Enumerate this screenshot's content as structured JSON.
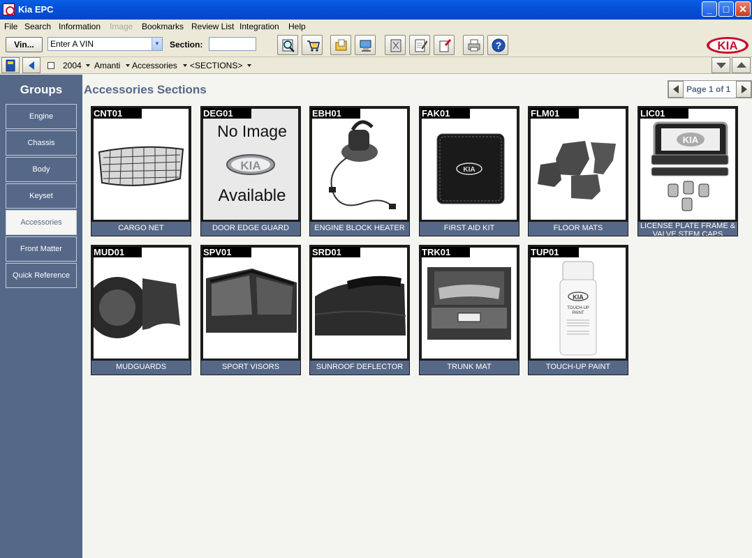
{
  "window": {
    "title": "Kia EPC",
    "minimize": "_",
    "maximize": "□",
    "close": "✕"
  },
  "menu": [
    {
      "label": "File",
      "disabled": false
    },
    {
      "label": "Search",
      "disabled": false
    },
    {
      "label": "Information",
      "disabled": false
    },
    {
      "label": "Image",
      "disabled": true
    },
    {
      "label": "Bookmarks",
      "disabled": false
    },
    {
      "label": "Review List",
      "disabled": false
    },
    {
      "label": "Integration",
      "disabled": false
    },
    {
      "label": "Help",
      "disabled": false
    }
  ],
  "toolbar": {
    "vin_button": "Vin...",
    "vin_select_value": "Enter A VIN",
    "section_label": "Section:",
    "section_value": "",
    "brand": "KIA"
  },
  "breadcrumb": {
    "year": "2004",
    "model": "Amanti",
    "group": "Accessories",
    "section": "<SECTIONS>"
  },
  "sidebar": {
    "heading": "Groups",
    "items": [
      {
        "label": "Engine",
        "active": false
      },
      {
        "label": "Chassis",
        "active": false
      },
      {
        "label": "Body",
        "active": false
      },
      {
        "label": "Keyset",
        "active": false
      },
      {
        "label": "Accessories",
        "active": true
      },
      {
        "label": "Front Matter",
        "active": false
      },
      {
        "label": "Quick Reference",
        "active": false
      }
    ]
  },
  "main": {
    "title": "Accessories Sections",
    "pager": "Page 1 of 1",
    "cards": [
      {
        "code": "CNT01",
        "label": "CARGO NET",
        "image": "cargo-net"
      },
      {
        "code": "DEG01",
        "label": "DOOR EDGE GUARD",
        "image": "no-image",
        "placeholder_top": "No Image",
        "placeholder_logo": "KIA",
        "placeholder_bottom": "Available"
      },
      {
        "code": "EBH01",
        "label": "ENGINE BLOCK HEATER",
        "image": "engine-block-heater"
      },
      {
        "code": "FAK01",
        "label": "FIRST AID KIT",
        "image": "first-aid-kit"
      },
      {
        "code": "FLM01",
        "label": "FLOOR MATS",
        "image": "floor-mats"
      },
      {
        "code": "LIC01",
        "label": "LICENSE PLATE FRAME & VALVE STEM CAPS",
        "image": "license-plate-frame"
      },
      {
        "code": "MUD01",
        "label": "MUDGUARDS",
        "image": "mudguards"
      },
      {
        "code": "SPV01",
        "label": "SPORT VISORS",
        "image": "sport-visors"
      },
      {
        "code": "SRD01",
        "label": "SUNROOF DEFLECTOR",
        "image": "sunroof-deflector"
      },
      {
        "code": "TRK01",
        "label": "TRUNK MAT",
        "image": "trunk-mat"
      },
      {
        "code": "TUP01",
        "label": "TOUCH-UP PAINT",
        "image": "touch-up-paint",
        "can_line1": "KIA",
        "can_line2": "TOUCH-UP",
        "can_line3": "PAINT"
      }
    ]
  }
}
